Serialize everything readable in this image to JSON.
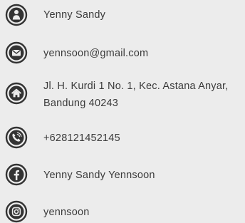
{
  "contact": {
    "name": "Yenny Sandy",
    "email": "yennsoon@gmail.com",
    "address_line1": "Jl. H. Kurdi 1 No. 1, Kec. Astana Anyar,",
    "address_line2": "Bandung 40243",
    "phone": "+628121452145",
    "facebook": "Yenny Sandy Yennsoon",
    "instagram": "yennsoon"
  },
  "icons": {
    "name": "person-icon",
    "email": "envelope-icon",
    "address": "home-icon",
    "phone": "phone-icon",
    "facebook": "facebook-icon",
    "instagram": "instagram-icon"
  },
  "colors": {
    "icon": "#333333",
    "background": "#ececec",
    "text": "#3b3b3b"
  }
}
